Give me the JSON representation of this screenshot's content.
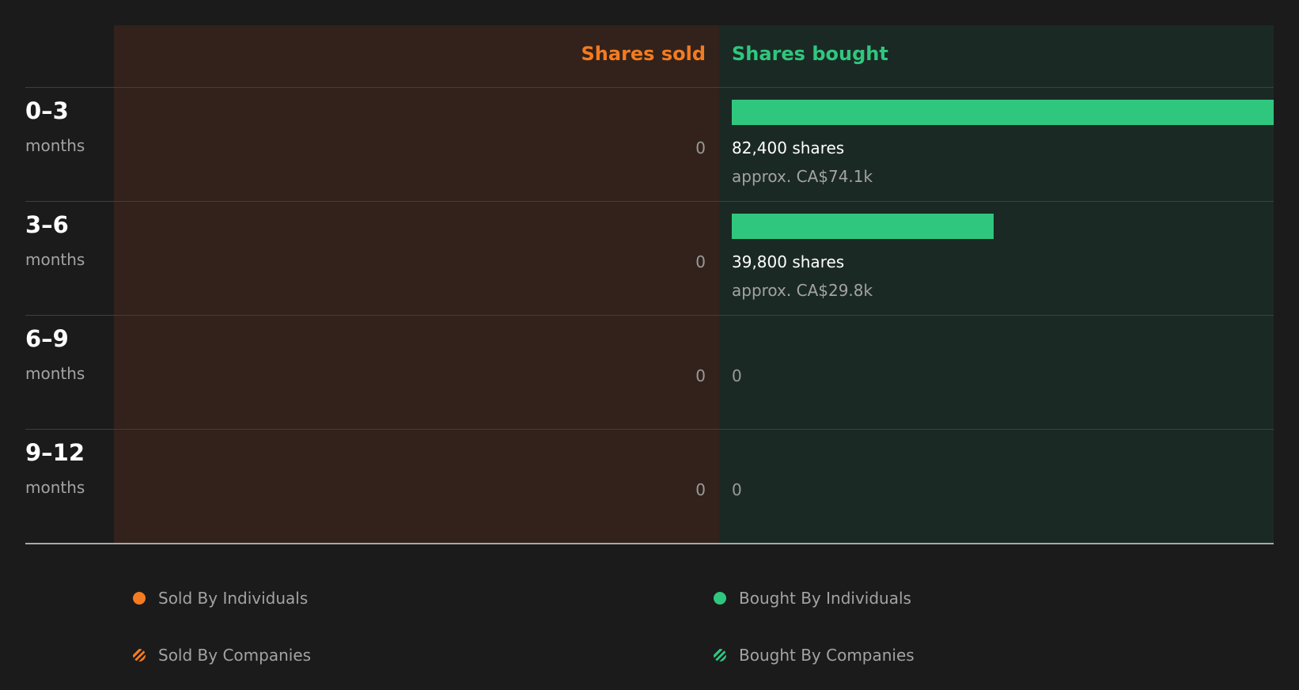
{
  "colors": {
    "background": "#1b1b1b",
    "sold": "#f47b20",
    "bought": "#2fc77e",
    "sold_panel": "#32221b",
    "bought_panel": "#1b2924"
  },
  "chart_data": {
    "type": "bar",
    "headers": {
      "sold": "Shares sold",
      "bought": "Shares bought"
    },
    "categories": [
      {
        "range": "0–3",
        "unit": "months"
      },
      {
        "range": "3–6",
        "unit": "months"
      },
      {
        "range": "6–9",
        "unit": "months"
      },
      {
        "range": "9–12",
        "unit": "months"
      }
    ],
    "series": [
      {
        "key": "sold",
        "values": [
          0,
          0,
          0,
          0
        ],
        "labels": [
          "0",
          "0",
          "0",
          "0"
        ]
      },
      {
        "key": "bought",
        "values": [
          82400,
          39800,
          0,
          0
        ],
        "labels": [
          "82,400 shares",
          "39,800 shares",
          "0",
          "0"
        ],
        "approx": [
          "approx. CA$74.1k",
          "approx. CA$29.8k",
          "",
          ""
        ]
      }
    ],
    "legend": [
      {
        "label": "Sold By Individuals",
        "icon": "solid-dot-icon",
        "color": "#f47b20"
      },
      {
        "label": "Bought By Individuals",
        "icon": "solid-dot-icon",
        "color": "#2fc77e"
      },
      {
        "label": "Sold By Companies",
        "icon": "striped-dot-icon",
        "color": "#f47b20"
      },
      {
        "label": "Bought By Companies",
        "icon": "striped-dot-icon",
        "color": "#2fc77e"
      }
    ]
  }
}
